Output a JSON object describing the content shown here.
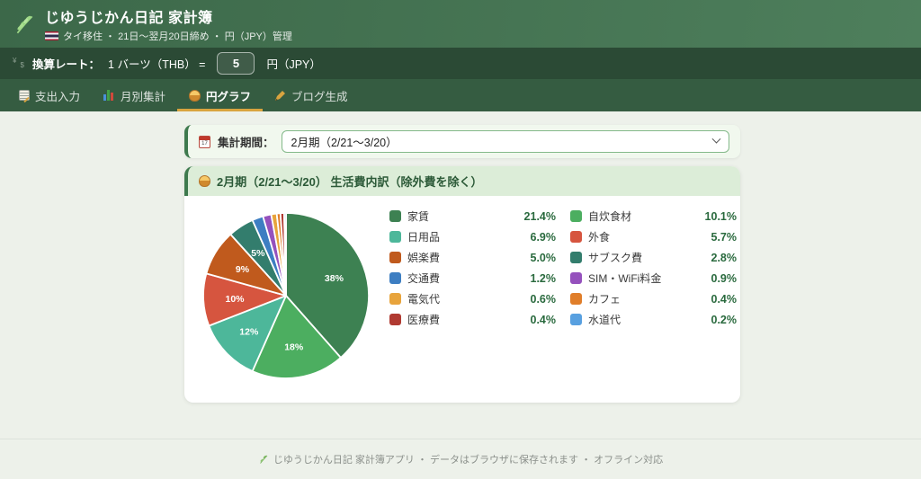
{
  "header": {
    "title": "じゆうじかん日記 家計簿",
    "subtitle": "タイ移住 ・ 21日〜翌月20日締め ・ 円（JPY）管理",
    "logo_icon": "herb-leaf-icon",
    "flag_icon": "thailand-flag-icon"
  },
  "rate_bar": {
    "icon": "currency-exchange-icon",
    "label": "換算レート：",
    "unit_left": "1 バーツ（THB） =",
    "value": "5",
    "unit_right": "円（JPY）"
  },
  "tabs": [
    {
      "label": "支出入力",
      "icon": "memo-icon",
      "active": false
    },
    {
      "label": "月別集計",
      "icon": "bar-chart-icon",
      "active": false
    },
    {
      "label": "円グラフ",
      "icon": "pie-icon",
      "active": true
    },
    {
      "label": "ブログ生成",
      "icon": "writing-hand-icon",
      "active": false
    }
  ],
  "period_selector": {
    "icon": "calendar-icon",
    "label": "集計期間：",
    "selected": "2月期（2/21〜3/20）"
  },
  "chart_card": {
    "icon": "pie-icon",
    "title": "2月期（2/21〜3/20） 生活費内訳（除外費を除く）"
  },
  "chart_data": {
    "type": "pie",
    "title": "2月期（2/21〜3/20） 生活費内訳（除外費を除く）",
    "legend_position": "right",
    "start_angle_deg": -90,
    "direction": "clockwise",
    "slices": [
      {
        "label": "家賃",
        "percent": 21.4,
        "percent_label": "21.4%",
        "pie_label": "38%",
        "color": "#3d8152"
      },
      {
        "label": "自炊食材",
        "percent": 10.1,
        "percent_label": "10.1%",
        "pie_label": "18%",
        "color": "#4cae60"
      },
      {
        "label": "日用品",
        "percent": 6.9,
        "percent_label": "6.9%",
        "pie_label": "12%",
        "color": "#4db79a"
      },
      {
        "label": "外食",
        "percent": 5.7,
        "percent_label": "5.7%",
        "pie_label": "10%",
        "color": "#d6553f"
      },
      {
        "label": "娯楽費",
        "percent": 5.0,
        "percent_label": "5.0%",
        "pie_label": "9%",
        "color": "#c05a1d"
      },
      {
        "label": "サブスク費",
        "percent": 2.8,
        "percent_label": "2.8%",
        "pie_label": "5%",
        "color": "#337d6d"
      },
      {
        "label": "交通費",
        "percent": 1.2,
        "percent_label": "1.2%",
        "pie_label": "",
        "color": "#3d7ec2"
      },
      {
        "label": "SIM・WiFi料金",
        "percent": 0.9,
        "percent_label": "0.9%",
        "pie_label": "",
        "color": "#9551bd"
      },
      {
        "label": "電気代",
        "percent": 0.6,
        "percent_label": "0.6%",
        "pie_label": "",
        "color": "#e8a43c"
      },
      {
        "label": "カフェ",
        "percent": 0.4,
        "percent_label": "0.4%",
        "pie_label": "",
        "color": "#e07e2a"
      },
      {
        "label": "医療費",
        "percent": 0.4,
        "percent_label": "0.4%",
        "pie_label": "",
        "color": "#b03a31"
      },
      {
        "label": "水道代",
        "percent": 0.2,
        "percent_label": "0.2%",
        "pie_label": "",
        "color": "#58a0e0"
      }
    ]
  },
  "footer": {
    "icon": "herb-leaf-icon",
    "text": "じゆうじかん日記 家計簿アプリ ・ データはブラウザに保存されます ・ オフライン対応"
  },
  "colors": {
    "header_gradient_start": "#3c6849",
    "header_gradient_end": "#4e7f5c",
    "rate_bar_bg": "#2b4a35",
    "tab_bar_bg": "#355c41",
    "active_tab_underline": "#d9a43f",
    "content_bg": "#edf1ea",
    "card_header_bg": "#dcedd8",
    "card_accent_green": "#3e7a4e",
    "percent_text": "#2a6a3e"
  }
}
